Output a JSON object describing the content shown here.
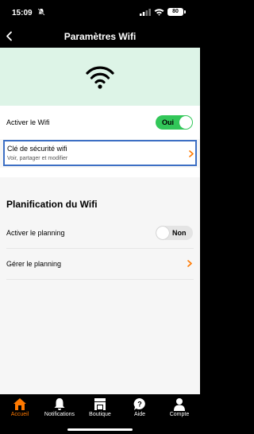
{
  "status_bar": {
    "time": "15:09",
    "battery": "80"
  },
  "nav": {
    "title": "Paramètres Wifi"
  },
  "wifi_toggle": {
    "label": "Activer le Wifi",
    "state": "Oui"
  },
  "security": {
    "title": "Clé de sécurité wifi",
    "subtitle": "Voir, partager et modifier"
  },
  "planning": {
    "section_title": "Planification du Wifi",
    "activate_label": "Activer le planning",
    "activate_state": "Non",
    "manage_label": "Gérer le planning"
  },
  "tabs": [
    {
      "label": "Accueil",
      "icon": "home-icon"
    },
    {
      "label": "Notifications",
      "icon": "bell-icon"
    },
    {
      "label": "Boutique",
      "icon": "shop-icon"
    },
    {
      "label": "Aide",
      "icon": "help-icon"
    },
    {
      "label": "Compte",
      "icon": "user-icon"
    }
  ],
  "colors": {
    "accent": "#ff7900",
    "toggle_on": "#32c759",
    "hero_bg": "#ddf4e7",
    "focus_border": "#3d6fc4"
  }
}
